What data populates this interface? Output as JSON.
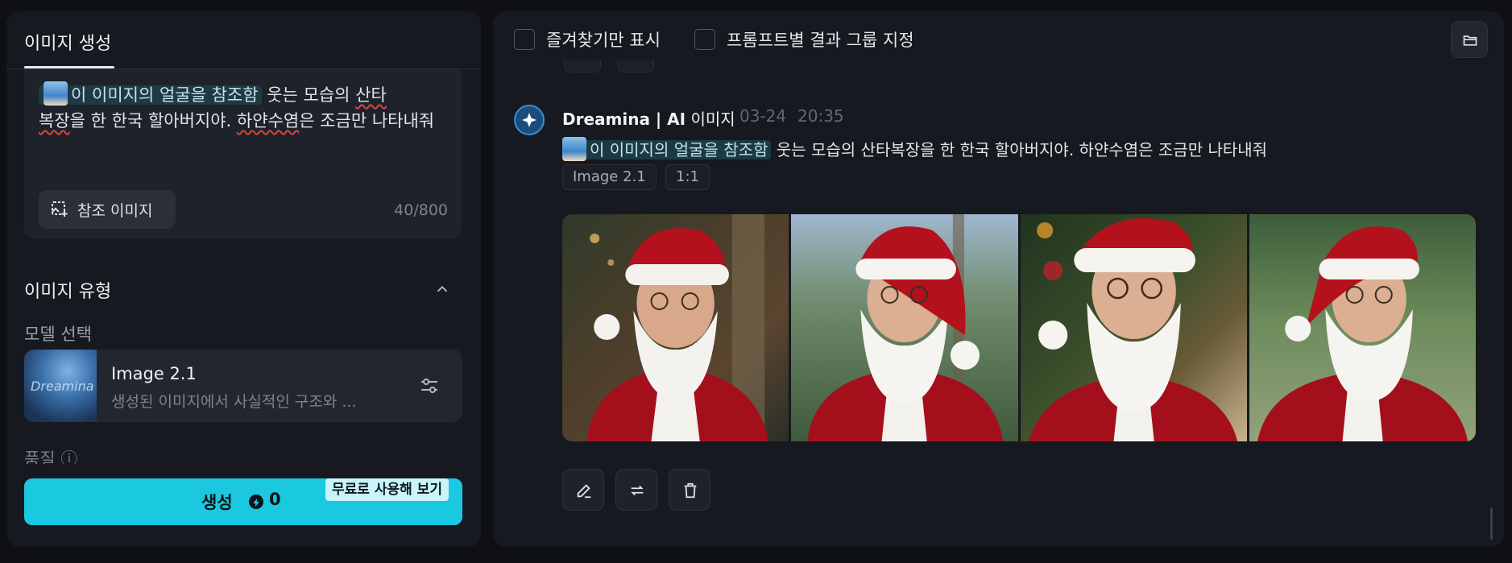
{
  "left_panel": {
    "tab_label": "이미지 생성",
    "prompt": {
      "ref_chip": "이 이미지의 얼굴을 참조함",
      "text_a": " 웃는 모습의 ",
      "text_b": "산타",
      "text_c": "복장",
      "text_d": "을 한 한국 할아버지야. ",
      "text_e": "하얀수염",
      "text_f": "은 조금만 나타내줘"
    },
    "ref_button_label": "참조 이미지",
    "char_counter": "40/800",
    "section_title": "이미지 유형",
    "model_select_label": "모델 선택",
    "model": {
      "thumb_text": "Dreamina",
      "name": "Image 2.1",
      "description": "생성된 이미지에서 사실적인 구조와 ..."
    },
    "quality_label": "품질 ⓘ",
    "generate": {
      "label": "생성",
      "credits": "0",
      "free_badge": "무료로 사용해 보기"
    }
  },
  "right_panel": {
    "filters": [
      {
        "label": "즐겨찾기만 표시",
        "checked": false
      },
      {
        "label": "프롬프트별 결과 그룹 지정",
        "checked": false
      }
    ],
    "post": {
      "author_brand": "Dreamina | AI",
      "author_kind": "이미지",
      "date": "03-24",
      "time": "20:35",
      "ref_chip": "이 이미지의 얼굴을 참조함",
      "prompt": "웃는 모습의 산타복장을 한 한국 할아버지야. 하얀수염은 조금만 나타내줘",
      "tags": [
        "Image 2.1",
        "1:1"
      ],
      "images": [
        "santa-1",
        "santa-2",
        "santa-3",
        "santa-4"
      ]
    },
    "actions": [
      "edit-icon",
      "regenerate-icon",
      "delete-icon"
    ]
  },
  "colors": {
    "accent": "#1ac8e0",
    "panel": "#16191f",
    "background": "#0e1014"
  }
}
